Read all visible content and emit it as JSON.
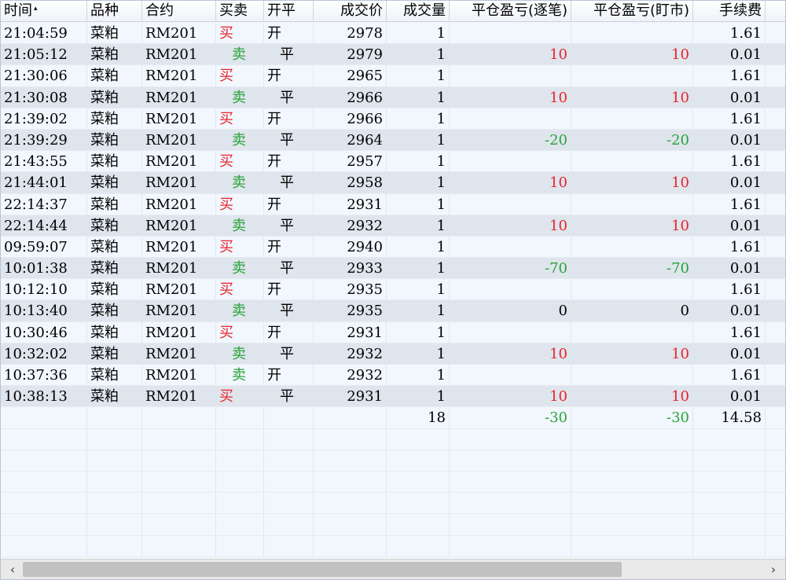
{
  "columns": [
    "时间",
    "品种",
    "合约",
    "买卖",
    "开平",
    "成交价",
    "成交量",
    "平仓盈亏(逐笔)",
    "平仓盈亏(盯市)",
    "手续费"
  ],
  "sort_indicator": "▴",
  "rows": [
    {
      "time": "21:04:59",
      "variety": "菜粕",
      "contract": "RM201",
      "side": "买",
      "offset": "开",
      "price": "2978",
      "volume": "1",
      "pnl_trade": "",
      "pnl_mtm": "",
      "fee": "1.61"
    },
    {
      "time": "21:05:12",
      "variety": "菜粕",
      "contract": "RM201",
      "side": "卖",
      "offset": "平",
      "price": "2979",
      "volume": "1",
      "pnl_trade": "10",
      "pnl_mtm": "10",
      "fee": "0.01"
    },
    {
      "time": "21:30:06",
      "variety": "菜粕",
      "contract": "RM201",
      "side": "买",
      "offset": "开",
      "price": "2965",
      "volume": "1",
      "pnl_trade": "",
      "pnl_mtm": "",
      "fee": "1.61"
    },
    {
      "time": "21:30:08",
      "variety": "菜粕",
      "contract": "RM201",
      "side": "卖",
      "offset": "平",
      "price": "2966",
      "volume": "1",
      "pnl_trade": "10",
      "pnl_mtm": "10",
      "fee": "0.01"
    },
    {
      "time": "21:39:02",
      "variety": "菜粕",
      "contract": "RM201",
      "side": "买",
      "offset": "开",
      "price": "2966",
      "volume": "1",
      "pnl_trade": "",
      "pnl_mtm": "",
      "fee": "1.61"
    },
    {
      "time": "21:39:29",
      "variety": "菜粕",
      "contract": "RM201",
      "side": "卖",
      "offset": "平",
      "price": "2964",
      "volume": "1",
      "pnl_trade": "-20",
      "pnl_mtm": "-20",
      "fee": "0.01"
    },
    {
      "time": "21:43:55",
      "variety": "菜粕",
      "contract": "RM201",
      "side": "买",
      "offset": "开",
      "price": "2957",
      "volume": "1",
      "pnl_trade": "",
      "pnl_mtm": "",
      "fee": "1.61"
    },
    {
      "time": "21:44:01",
      "variety": "菜粕",
      "contract": "RM201",
      "side": "卖",
      "offset": "平",
      "price": "2958",
      "volume": "1",
      "pnl_trade": "10",
      "pnl_mtm": "10",
      "fee": "0.01"
    },
    {
      "time": "22:14:37",
      "variety": "菜粕",
      "contract": "RM201",
      "side": "买",
      "offset": "开",
      "price": "2931",
      "volume": "1",
      "pnl_trade": "",
      "pnl_mtm": "",
      "fee": "1.61"
    },
    {
      "time": "22:14:44",
      "variety": "菜粕",
      "contract": "RM201",
      "side": "卖",
      "offset": "平",
      "price": "2932",
      "volume": "1",
      "pnl_trade": "10",
      "pnl_mtm": "10",
      "fee": "0.01"
    },
    {
      "time": "09:59:07",
      "variety": "菜粕",
      "contract": "RM201",
      "side": "买",
      "offset": "开",
      "price": "2940",
      "volume": "1",
      "pnl_trade": "",
      "pnl_mtm": "",
      "fee": "1.61"
    },
    {
      "time": "10:01:38",
      "variety": "菜粕",
      "contract": "RM201",
      "side": "卖",
      "offset": "平",
      "price": "2933",
      "volume": "1",
      "pnl_trade": "-70",
      "pnl_mtm": "-70",
      "fee": "0.01"
    },
    {
      "time": "10:12:10",
      "variety": "菜粕",
      "contract": "RM201",
      "side": "买",
      "offset": "开",
      "price": "2935",
      "volume": "1",
      "pnl_trade": "",
      "pnl_mtm": "",
      "fee": "1.61"
    },
    {
      "time": "10:13:40",
      "variety": "菜粕",
      "contract": "RM201",
      "side": "卖",
      "offset": "平",
      "price": "2935",
      "volume": "1",
      "pnl_trade": "0",
      "pnl_mtm": "0",
      "fee": "0.01"
    },
    {
      "time": "10:30:46",
      "variety": "菜粕",
      "contract": "RM201",
      "side": "买",
      "offset": "开",
      "price": "2931",
      "volume": "1",
      "pnl_trade": "",
      "pnl_mtm": "",
      "fee": "1.61"
    },
    {
      "time": "10:32:02",
      "variety": "菜粕",
      "contract": "RM201",
      "side": "卖",
      "offset": "平",
      "price": "2932",
      "volume": "1",
      "pnl_trade": "10",
      "pnl_mtm": "10",
      "fee": "0.01"
    },
    {
      "time": "10:37:36",
      "variety": "菜粕",
      "contract": "RM201",
      "side": "卖",
      "offset": "开",
      "price": "2932",
      "volume": "1",
      "pnl_trade": "",
      "pnl_mtm": "",
      "fee": "1.61"
    },
    {
      "time": "10:38:13",
      "variety": "菜粕",
      "contract": "RM201",
      "side": "买",
      "offset": "平",
      "price": "2931",
      "volume": "1",
      "pnl_trade": "10",
      "pnl_mtm": "10",
      "fee": "0.01"
    }
  ],
  "totals": {
    "volume": "18",
    "pnl_trade": "-30",
    "pnl_mtm": "-30",
    "fee": "14.58"
  },
  "colors": {
    "buy": "#e8232a",
    "sell": "#2aa23a",
    "profit": "#e8232a",
    "loss": "#2aa23a",
    "zero": "#000000"
  },
  "scrollbar": {
    "left_icon": "‹",
    "right_icon": "›"
  }
}
